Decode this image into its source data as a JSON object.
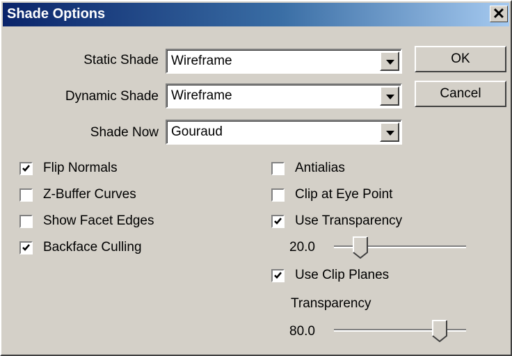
{
  "window": {
    "title": "Shade Options",
    "close_label": "✕"
  },
  "fields": {
    "static_shade": {
      "label": "Static Shade",
      "value": "Wireframe"
    },
    "dynamic_shade": {
      "label": "Dynamic Shade",
      "value": "Wireframe"
    },
    "shade_now": {
      "label": "Shade Now",
      "value": "Gouraud"
    }
  },
  "buttons": {
    "ok": "OK",
    "cancel": "Cancel"
  },
  "options_left": [
    {
      "label": "Flip Normals",
      "checked": true
    },
    {
      "label": "Z-Buffer Curves",
      "checked": false
    },
    {
      "label": "Show Facet Edges",
      "checked": false
    },
    {
      "label": "Backface Culling",
      "checked": true
    }
  ],
  "options_right": [
    {
      "label": "Antialias",
      "checked": false
    },
    {
      "label": "Clip at Eye Point",
      "checked": false
    },
    {
      "label": "Use Transparency",
      "checked": true
    },
    {
      "label": "Use Clip Planes",
      "checked": true
    }
  ],
  "transparency_slider": {
    "value_text": "20.0",
    "fraction": 0.2
  },
  "clip_transparency": {
    "label": "Transparency",
    "value_text": "80.0",
    "fraction": 0.8
  }
}
